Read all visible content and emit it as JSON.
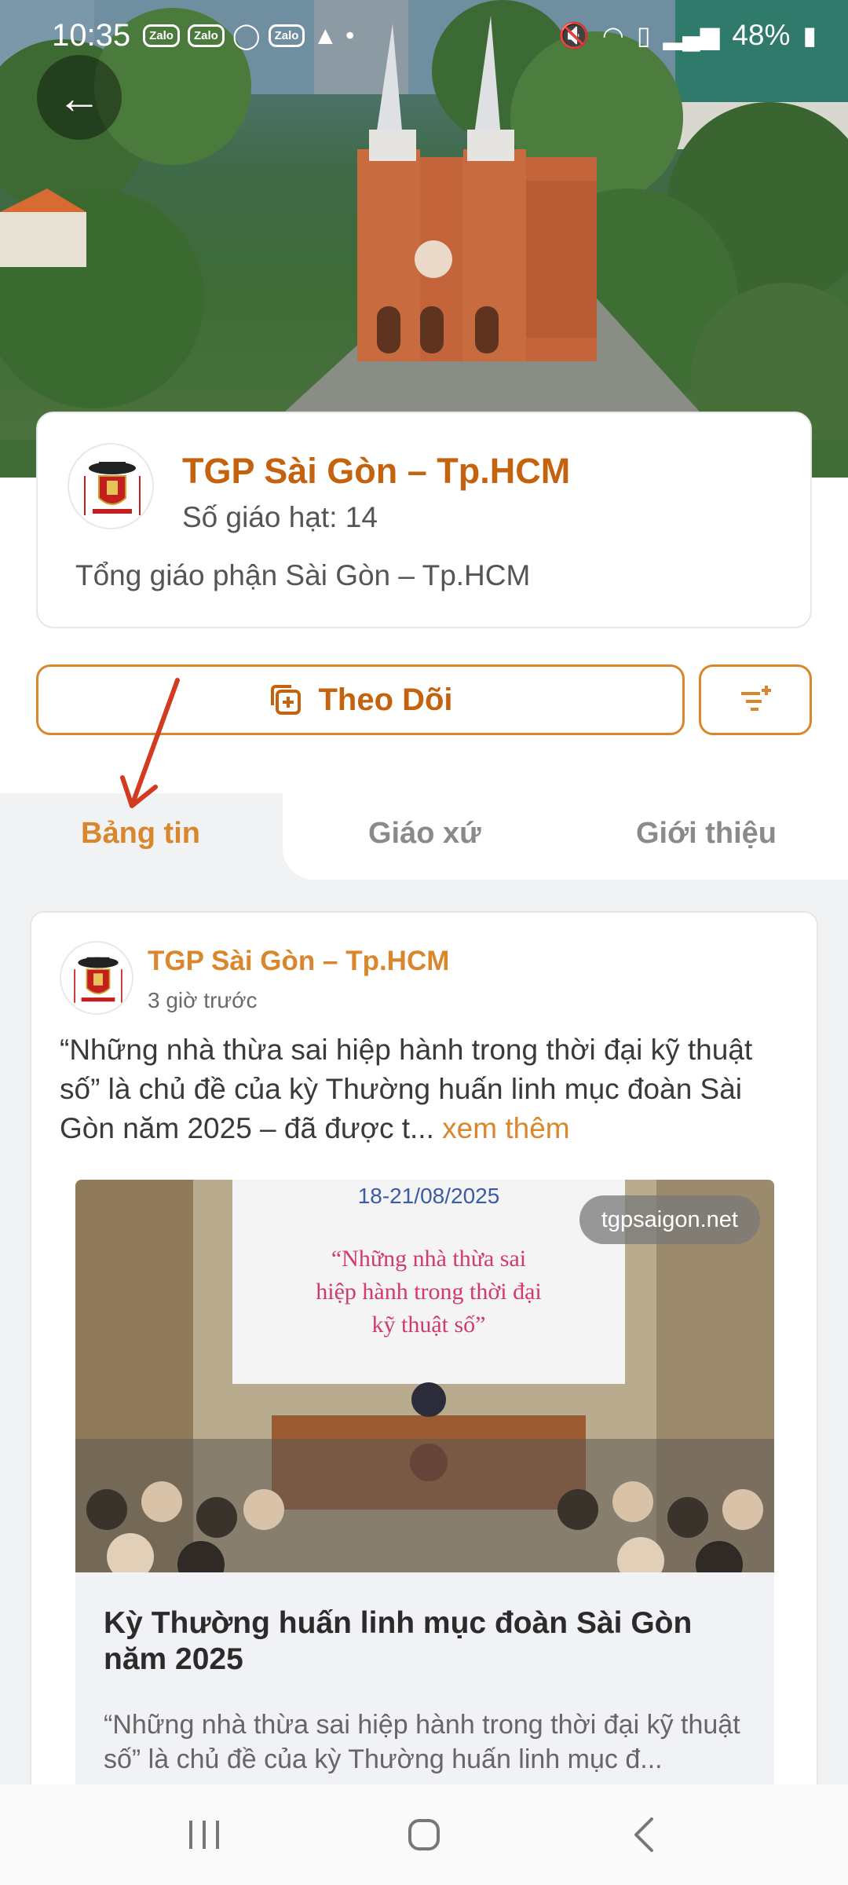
{
  "status_bar": {
    "time": "10:35",
    "notif_chips": [
      "Zalo",
      "Zalo",
      "Zalo"
    ],
    "battery": "48%"
  },
  "profile": {
    "name": "TGP Sài Gòn – Tp.HCM",
    "subtitle": "Số giáo hạt: 14",
    "description": "Tổng giáo phận Sài Gòn – Tp.HCM"
  },
  "actions": {
    "follow_label": "Theo Dõi"
  },
  "tabs": [
    {
      "label": "Bảng tin",
      "active": true
    },
    {
      "label": "Giáo xứ",
      "active": false
    },
    {
      "label": "Giới thiệu",
      "active": false
    }
  ],
  "post": {
    "author": "TGP Sài Gòn – Tp.HCM",
    "time": "3 giờ trước",
    "text": "“Những nhà thừa sai hiệp hành trong thời đại kỹ thuật số” là chủ đề của kỳ Thường huấn linh mục đoàn Sài Gòn năm 2025 – đã được t...",
    "see_more": "xem thêm",
    "link": {
      "source": "tgpsaigon.net",
      "image_date": "18-21/08/2025",
      "image_caption": "“Những nhà thừa sai hiệp hành trong thời đại kỹ thuật số”",
      "title": "Kỳ Thường huấn linh mục đoàn Sài Gòn năm 2025",
      "description": "“Những nhà thừa sai hiệp hành trong thời đại kỹ thuật số” là chủ đề của kỳ Thường huấn linh mục đ..."
    }
  },
  "colors": {
    "accent": "#d9862c",
    "accent_dark": "#c5620e",
    "tab_bg": "#f0f2f4"
  },
  "icons": {
    "back": "arrow-left-icon",
    "follow": "add-copy-icon",
    "filter": "filter-add-icon",
    "nav": [
      "recents-icon",
      "home-icon",
      "back-icon"
    ]
  }
}
